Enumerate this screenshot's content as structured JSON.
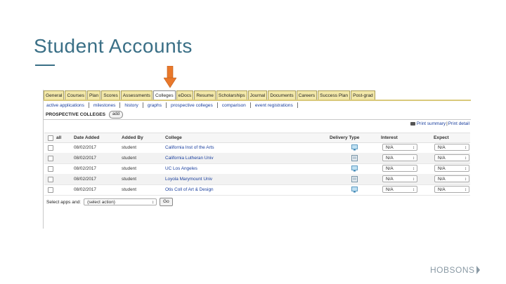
{
  "slide": {
    "title": "Student Accounts",
    "brand": "HOBSONS"
  },
  "tabs": [
    {
      "label": "General"
    },
    {
      "label": "Courses"
    },
    {
      "label": "Plan"
    },
    {
      "label": "Scores"
    },
    {
      "label": "Assessments"
    },
    {
      "label": "Colleges",
      "active": true
    },
    {
      "label": "eDocs"
    },
    {
      "label": "Resume"
    },
    {
      "label": "Scholarships"
    },
    {
      "label": "Journal"
    },
    {
      "label": "Documents"
    },
    {
      "label": "Careers"
    },
    {
      "label": "Success Plan"
    },
    {
      "label": "Post-grad"
    }
  ],
  "subnav": [
    {
      "label": "active applications"
    },
    {
      "label": "milestones"
    },
    {
      "label": "history"
    },
    {
      "label": "graphs"
    },
    {
      "label": "prospective colleges"
    },
    {
      "label": "comparison"
    },
    {
      "label": "event registrations"
    }
  ],
  "section": {
    "heading": "PROSPECTIVE COLLEGES",
    "add_label": "add"
  },
  "print": {
    "summary": "Print summary",
    "separator": "|",
    "detail": "Print detail"
  },
  "columns": {
    "all": "all",
    "date_added": "Date Added",
    "added_by": "Added By",
    "college": "College",
    "delivery_type": "Delivery Type",
    "interest": "Interest",
    "expect": "Expect"
  },
  "rows": [
    {
      "date": "08/02/2017",
      "added_by": "student",
      "college": "California Inst of the Arts",
      "delivery_icon": "computer-icon",
      "interest": "N/A",
      "expect": "N/A"
    },
    {
      "date": "08/02/2017",
      "added_by": "student",
      "college": "California Lutheran Univ",
      "delivery_icon": "paper-icon",
      "interest": "N/A",
      "expect": "N/A"
    },
    {
      "date": "08/02/2017",
      "added_by": "student",
      "college": "UC Los Angeles",
      "delivery_icon": "computer-icon",
      "interest": "N/A",
      "expect": "N/A"
    },
    {
      "date": "08/02/2017",
      "added_by": "student",
      "college": "Loyola Marymount Univ",
      "delivery_icon": "paper-icon",
      "interest": "N/A",
      "expect": "N/A"
    },
    {
      "date": "08/02/2017",
      "added_by": "student",
      "college": "Otis Coll of Art & Design",
      "delivery_icon": "computer-icon",
      "interest": "N/A",
      "expect": "N/A"
    }
  ],
  "footer": {
    "label": "Select apps and:",
    "action_value": "(select action)",
    "go_label": "Go"
  },
  "colors": {
    "title": "#3a6f86",
    "tab_bg": "#f3e8a9",
    "link": "#1a3f9e",
    "arrow": "#e9782b"
  }
}
